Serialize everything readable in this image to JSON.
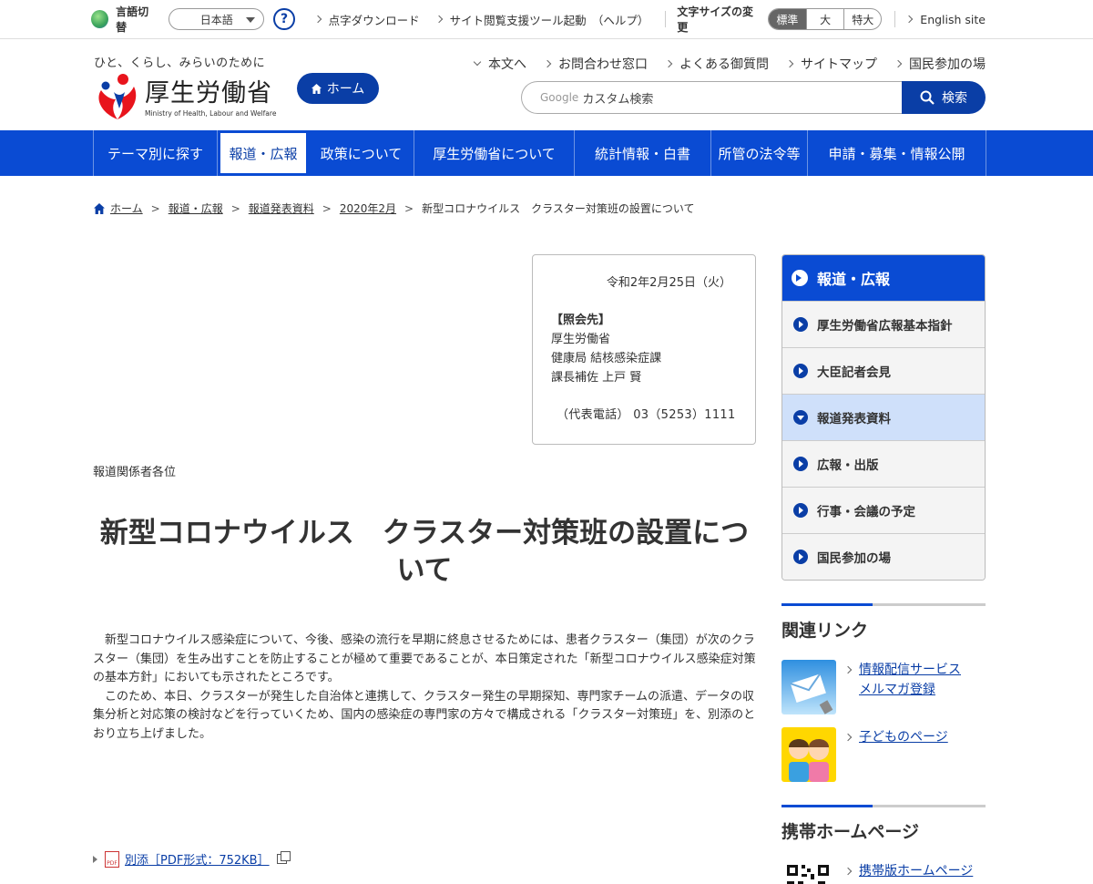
{
  "utility": {
    "lang_label": "言語切替",
    "lang_value": "日本語",
    "help": "?",
    "braille": "点字ダウンロード",
    "support_tool": "サイト閲覧支援ツール起動　（ヘルプ）",
    "font_size_label": "文字サイズの変更",
    "font_sizes": [
      "標準",
      "大",
      "特大"
    ],
    "english": "English site"
  },
  "header": {
    "tagline": "ひと、くらし、みらいのために",
    "logo_text": "厚生労働省",
    "logo_sub": "Ministry of Health, Labour and Welfare",
    "home_button": "ホーム",
    "links": [
      "本文へ",
      "お問合わせ窓口",
      "よくある御質問",
      "サイトマップ",
      "国民参加の場"
    ],
    "search_google": "Google",
    "search_placeholder": "カスタム検索",
    "search_button": "検索"
  },
  "nav": [
    {
      "label": "テーマ別に探す"
    },
    {
      "label": "報道・広報",
      "active": true
    },
    {
      "label": "政策について"
    },
    {
      "label": "厚生労働省について"
    },
    {
      "label": "統計情報・白書"
    },
    {
      "label": "所管の法令等"
    },
    {
      "label": "申請・募集・情報公開"
    }
  ],
  "breadcrumb": [
    "ホーム",
    "報道・広報",
    "報道発表資料",
    "2020年2月",
    "新型コロナウイルス　クラスター対策班の設置について"
  ],
  "contact": {
    "date": "令和2年2月25日（火）",
    "heading": "【照会先】",
    "lines": [
      "厚生労働省",
      "健康局 結核感染症課",
      "課長補佐 上戸 賢"
    ],
    "phone": "（代表電話） 03（5253）1111"
  },
  "to_press": "報道関係者各位",
  "title": "新型コロナウイルス　クラスター対策班の設置について",
  "paragraphs": [
    "新型コロナウイルス感染症について、今後、感染の流行を早期に終息させるためには、患者クラスター（集団）が次のクラスター（集団）を生み出すことを防止することが極めて重要であることが、本日策定された「新型コロナウイルス感染症対策の基本方針」においても示されたところです。",
    "このため、本日、クラスターが発生した自治体と連携して、クラスター発生の早期探知、専門家チームの派遣、データの収集分析と対応策の検討などを行っていくため、国内の感染症の専門家の方々で構成される「クラスター対策班」を、別添のとおり立ち上げました。"
  ],
  "attachment": {
    "label": "別添［PDF形式：752KB］",
    "pdf": "PDF"
  },
  "sidebar": {
    "heading": "報道・広報",
    "items": [
      "厚生労働省広報基本指針",
      "大臣記者会見",
      "報道発表資料",
      "広報・出版",
      "行事・会議の予定",
      "国民参加の場"
    ],
    "current_index": 2,
    "related_heading": "関連リンク",
    "related_links": [
      "情報配信サービスメルマガ登録",
      "子どものページ"
    ],
    "mobile_heading": "携帯ホームページ",
    "mobile_link": "携帯版ホームページ"
  },
  "colors": {
    "primary": "#0a4bd3",
    "dark_blue": "#0a3ea6",
    "current_bg": "#cfe0fa"
  }
}
